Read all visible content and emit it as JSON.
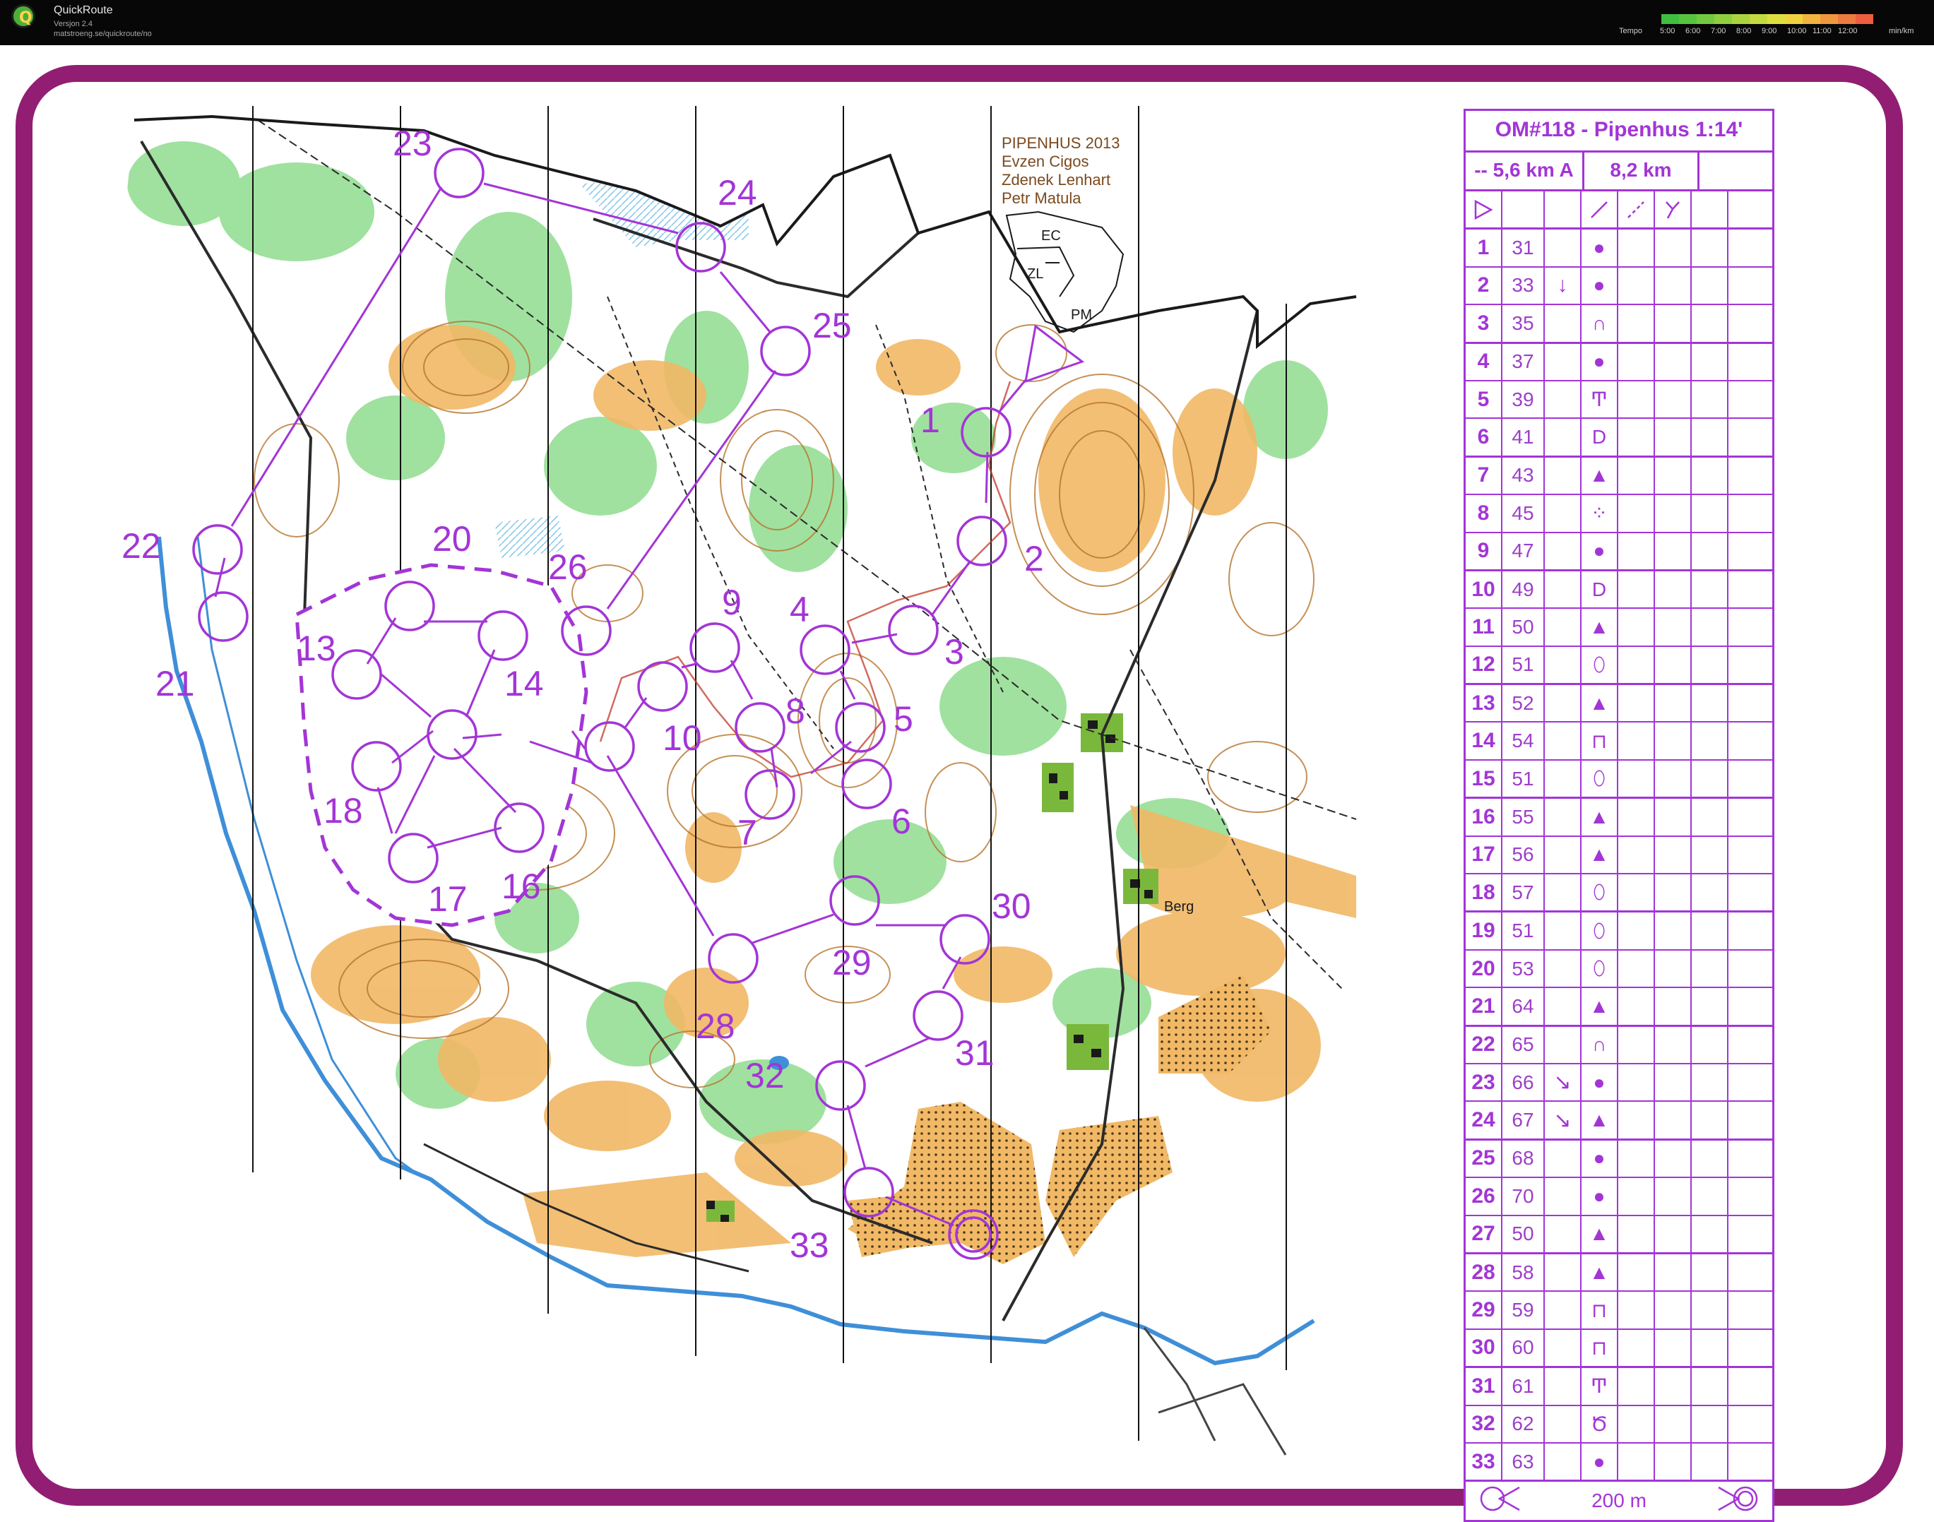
{
  "app": {
    "title": "QuickRoute",
    "version": "Versjon 2.4",
    "url": "matstroeng.se/quickroute/no"
  },
  "tempo": {
    "label": "Tempo",
    "unit": "min/km",
    "ticks": [
      "5:00",
      "6:00",
      "7:00",
      "8:00",
      "9:00",
      "10:00",
      "11:00",
      "12:00"
    ],
    "colors": [
      "#3fbf3f",
      "#57c43f",
      "#72c93f",
      "#8ecf3f",
      "#a9d43f",
      "#c4d93f",
      "#dfde3f",
      "#f0d23f",
      "#f0b43f",
      "#ef973f",
      "#ee7a3f",
      "#ed5d3f"
    ]
  },
  "colors": {
    "frame": "#911e72",
    "course": "#a335d6",
    "open_land": "#f1b866",
    "green": "#7fd47f",
    "contour": "#b7752d",
    "path": "#2b2b2b",
    "water": "#3f8fd8"
  },
  "map": {
    "credits": [
      "PIPENHUS 2013",
      "Evzen Cigos",
      "Zdenek Lenhart",
      "Petr Matula"
    ],
    "sector_labels": [
      "EC",
      "ZL",
      "PM"
    ],
    "place_label": "Berg",
    "control_labels": [
      "1",
      "2",
      "3",
      "4",
      "5",
      "6",
      "7",
      "8",
      "9",
      "10",
      "13",
      "14",
      "16",
      "17",
      "18",
      "20",
      "21",
      "22",
      "23",
      "24",
      "25",
      "26",
      "28",
      "29",
      "30",
      "31",
      "32",
      "33"
    ]
  },
  "description": {
    "title": "OM#118 - Pipenhus 1:14'",
    "course": "-- 5,6 km A",
    "length": "8,2 km",
    "controls": [
      {
        "n": "1",
        "code": "31",
        "dir": "",
        "symbol": "●"
      },
      {
        "n": "2",
        "code": "33",
        "dir": "↓",
        "symbol": "●"
      },
      {
        "n": "3",
        "code": "35",
        "dir": "",
        "symbol": "∩"
      },
      {
        "n": "4",
        "code": "37",
        "dir": "",
        "symbol": "●"
      },
      {
        "n": "5",
        "code": "39",
        "dir": "",
        "symbol": "Ͳ"
      },
      {
        "n": "6",
        "code": "41",
        "dir": "",
        "symbol": "D"
      },
      {
        "n": "7",
        "code": "43",
        "dir": "",
        "symbol": "▲"
      },
      {
        "n": "8",
        "code": "45",
        "dir": "",
        "symbol": "⁘"
      },
      {
        "n": "9",
        "code": "47",
        "dir": "",
        "symbol": "●"
      },
      {
        "n": "10",
        "code": "49",
        "dir": "",
        "symbol": "D"
      },
      {
        "n": "11",
        "code": "50",
        "dir": "",
        "symbol": "▲"
      },
      {
        "n": "12",
        "code": "51",
        "dir": "",
        "symbol": "⬯"
      },
      {
        "n": "13",
        "code": "52",
        "dir": "",
        "symbol": "▲"
      },
      {
        "n": "14",
        "code": "54",
        "dir": "",
        "symbol": "⊓"
      },
      {
        "n": "15",
        "code": "51",
        "dir": "",
        "symbol": "⬯"
      },
      {
        "n": "16",
        "code": "55",
        "dir": "",
        "symbol": "▲"
      },
      {
        "n": "17",
        "code": "56",
        "dir": "",
        "symbol": "▲"
      },
      {
        "n": "18",
        "code": "57",
        "dir": "",
        "symbol": "⬯"
      },
      {
        "n": "19",
        "code": "51",
        "dir": "",
        "symbol": "⬯"
      },
      {
        "n": "20",
        "code": "53",
        "dir": "",
        "symbol": "⬯"
      },
      {
        "n": "21",
        "code": "64",
        "dir": "",
        "symbol": "▲"
      },
      {
        "n": "22",
        "code": "65",
        "dir": "",
        "symbol": "∩"
      },
      {
        "n": "23",
        "code": "66",
        "dir": "↘",
        "symbol": "●"
      },
      {
        "n": "24",
        "code": "67",
        "dir": "↘",
        "symbol": "▲"
      },
      {
        "n": "25",
        "code": "68",
        "dir": "",
        "symbol": "●"
      },
      {
        "n": "26",
        "code": "70",
        "dir": "",
        "symbol": "●"
      },
      {
        "n": "27",
        "code": "50",
        "dir": "",
        "symbol": "▲"
      },
      {
        "n": "28",
        "code": "58",
        "dir": "",
        "symbol": "▲"
      },
      {
        "n": "29",
        "code": "59",
        "dir": "",
        "symbol": "⊓"
      },
      {
        "n": "30",
        "code": "60",
        "dir": "",
        "symbol": "⊓"
      },
      {
        "n": "31",
        "code": "61",
        "dir": "",
        "symbol": "Ͳ"
      },
      {
        "n": "32",
        "code": "62",
        "dir": "",
        "symbol": "Ծ"
      },
      {
        "n": "33",
        "code": "63",
        "dir": "",
        "symbol": "●"
      }
    ],
    "finish": "200 m"
  }
}
